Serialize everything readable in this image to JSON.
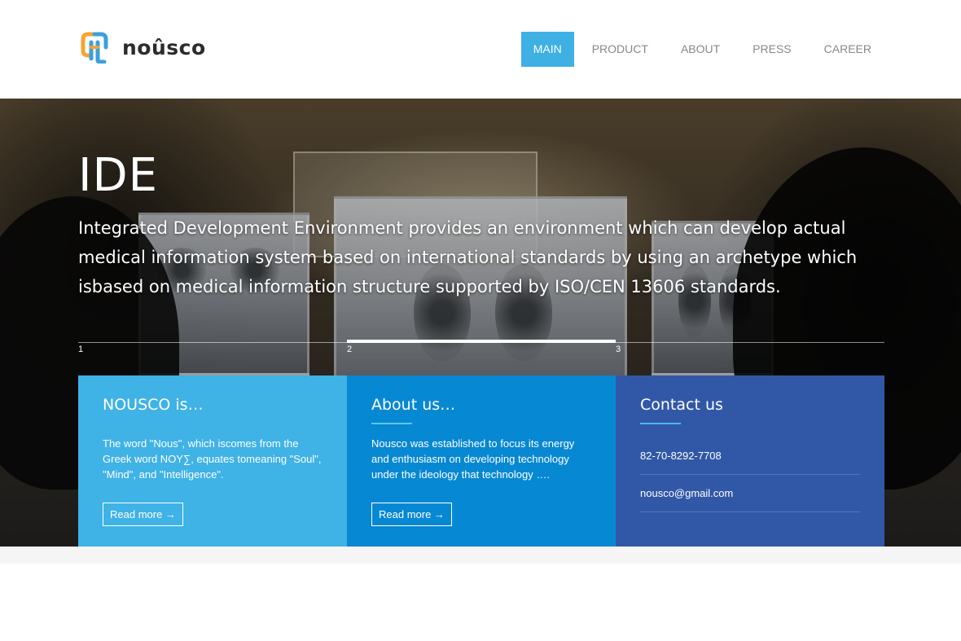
{
  "brand": {
    "name": "noûsco"
  },
  "nav": {
    "items": [
      {
        "label": "MAIN",
        "active": true
      },
      {
        "label": "PRODUCT",
        "active": false
      },
      {
        "label": "ABOUT",
        "active": false
      },
      {
        "label": "PRESS",
        "active": false
      },
      {
        "label": "CAREER",
        "active": false
      }
    ]
  },
  "hero": {
    "title": "IDE",
    "description": "Integrated Development Environment provides an environment which can develop actual medical information system based on international standards by using an archetype which isbased on medical information structure supported by ISO/CEN 13606 standards.",
    "slides": [
      "1",
      "2",
      "3"
    ],
    "active_slide": 2
  },
  "panels": {
    "nousco": {
      "title": "NOUSCO is…",
      "text": "The word \"Nous\", which iscomes from the Greek word NOY∑, equates tomeaning \"Soul\", \"Mind\", and \"Intelligence\".",
      "button": "Read more →"
    },
    "about": {
      "title": "About us…",
      "text": "Nousco was established to focus its energy and enthusiasm on developing technology under the ideology that technology ….",
      "button": "Read more →"
    },
    "contact": {
      "title": "Contact us",
      "phone": "82-70-8292-7708",
      "email": "nousco@gmail.com"
    }
  },
  "colors": {
    "accent": "#3fb0e4",
    "panel_light": "#3fb2e6",
    "panel_mid": "#0788d2",
    "panel_dark": "#3158a6"
  }
}
